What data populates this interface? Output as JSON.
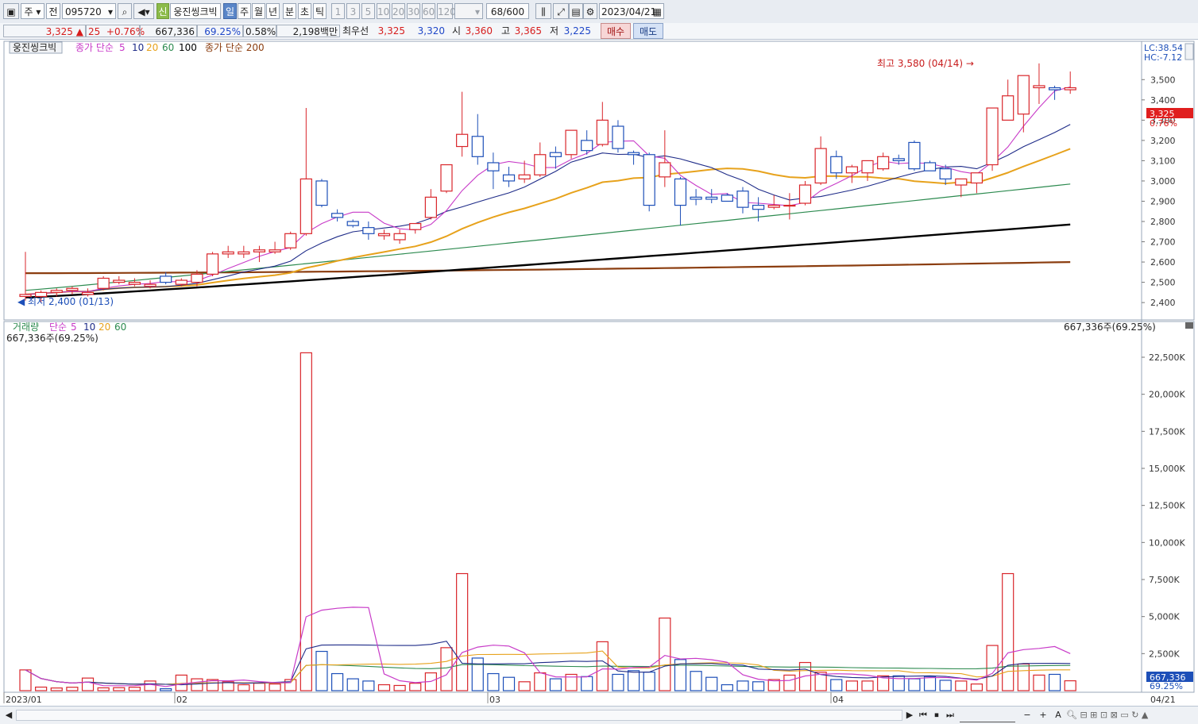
{
  "toolbar": {
    "market": "주",
    "prev": "전",
    "code": "095720",
    "new_badge": "신",
    "name": "웅진씽크빅",
    "periods": [
      "일",
      "주",
      "월",
      "년",
      "분",
      "초",
      "틱"
    ],
    "active_period": "일",
    "minutes": [
      "1",
      "3",
      "5",
      "10",
      "20",
      "30",
      "60",
      "120"
    ],
    "count": "68",
    "count_total": "/600",
    "date": "2023/04/21"
  },
  "info": {
    "price": "3,325",
    "arrow": "▲",
    "change": "25",
    "change_pct": "+0.76%",
    "volume": "667,336",
    "vol_ratio": "69.25%",
    "turnover": "0.58%",
    "amount": "2,198백만",
    "bid_label": "최우선",
    "ask": "3,325",
    "bid": "3,320",
    "open_label": "시",
    "open": "3,360",
    "high_label": "고",
    "high": "3,365",
    "low_label": "저",
    "low": "3,225",
    "buy": "매수",
    "sell": "매도"
  },
  "colors": {
    "up": "#d9262b",
    "down": "#1d4fb8",
    "ma5": "#c83bc8",
    "ma10": "#1e2b88",
    "ma20": "#e7a21c",
    "ma60": "#2c8a4f",
    "ma100": "#000000",
    "ma200": "#8b3d0f"
  },
  "chart_data": [
    {
      "type": "candlestick",
      "title": "웅진씽크빅",
      "legend": {
        "label": "종가 단순",
        "periods": [
          "5",
          "10",
          "20",
          "60",
          "100"
        ],
        "ma200_label": "종가 단순 200"
      },
      "lc": "LC:38.54",
      "hc": "HC:-7.12",
      "price_tag": "3,325",
      "pct_tag": "0.76%",
      "max_label": "최고 3,580 (04/14)",
      "min_label": "최저 2,400 (01/13)",
      "ylim": [
        2330,
        3650
      ],
      "yticks": [
        2400,
        2500,
        2600,
        2700,
        2800,
        2900,
        3000,
        3100,
        3200,
        3300,
        3400,
        3500
      ],
      "ytick_labels": [
        "2,400",
        "2,500",
        "2,600",
        "2,700",
        "2,800",
        "2,900",
        "3,000",
        "3,100",
        "3,200",
        "3,300",
        "3,400",
        "3,500"
      ],
      "xlabels": [
        "2023/01",
        "02",
        "03",
        "04"
      ],
      "x_end_label": "04/21",
      "ohlc": [
        [
          2430,
          2650,
          2410,
          2440
        ],
        [
          2430,
          2460,
          2400,
          2450
        ],
        [
          2450,
          2470,
          2430,
          2460
        ],
        [
          2460,
          2480,
          2440,
          2470
        ],
        [
          2440,
          2470,
          2430,
          2450
        ],
        [
          2470,
          2530,
          2460,
          2520
        ],
        [
          2500,
          2530,
          2490,
          2510
        ],
        [
          2490,
          2520,
          2480,
          2500
        ],
        [
          2480,
          2510,
          2470,
          2490
        ],
        [
          2530,
          2550,
          2490,
          2500
        ],
        [
          2490,
          2520,
          2480,
          2510
        ],
        [
          2500,
          2560,
          2480,
          2540
        ],
        [
          2540,
          2650,
          2530,
          2640
        ],
        [
          2640,
          2680,
          2620,
          2650
        ],
        [
          2640,
          2680,
          2620,
          2650
        ],
        [
          2650,
          2680,
          2600,
          2660
        ],
        [
          2650,
          2700,
          2640,
          2660
        ],
        [
          2670,
          2750,
          2660,
          2740
        ],
        [
          2740,
          3360,
          2730,
          3010
        ],
        [
          3000,
          3010,
          2870,
          2880
        ],
        [
          2840,
          2860,
          2800,
          2820
        ],
        [
          2800,
          2810,
          2770,
          2780
        ],
        [
          2770,
          2800,
          2710,
          2740
        ],
        [
          2730,
          2760,
          2710,
          2740
        ],
        [
          2710,
          2760,
          2690,
          2740
        ],
        [
          2760,
          2790,
          2740,
          2790
        ],
        [
          2820,
          2960,
          2810,
          2920
        ],
        [
          2950,
          3080,
          2940,
          3080
        ],
        [
          3170,
          3440,
          3120,
          3230
        ],
        [
          3220,
          3330,
          3080,
          3120
        ],
        [
          3090,
          3140,
          2960,
          3050
        ],
        [
          3030,
          3070,
          2970,
          3000
        ],
        [
          3010,
          3100,
          2990,
          3030
        ],
        [
          3030,
          3190,
          3020,
          3130
        ],
        [
          3140,
          3170,
          3060,
          3120
        ],
        [
          3130,
          3250,
          3110,
          3250
        ],
        [
          3200,
          3250,
          3130,
          3150
        ],
        [
          3180,
          3390,
          3170,
          3300
        ],
        [
          3270,
          3300,
          3140,
          3160
        ],
        [
          3140,
          3150,
          3080,
          3130
        ],
        [
          3130,
          3140,
          2850,
          2880
        ],
        [
          3020,
          3250,
          2970,
          3090
        ],
        [
          3010,
          3020,
          2780,
          2880
        ],
        [
          2920,
          2960,
          2880,
          2910
        ],
        [
          2920,
          2960,
          2890,
          2910
        ],
        [
          2930,
          2940,
          2900,
          2900
        ],
        [
          2950,
          2970,
          2840,
          2870
        ],
        [
          2880,
          2920,
          2800,
          2860
        ],
        [
          2870,
          2930,
          2860,
          2880
        ],
        [
          2880,
          2940,
          2810,
          2880
        ],
        [
          2890,
          3000,
          2880,
          2980
        ],
        [
          2990,
          3220,
          2980,
          3160
        ],
        [
          3120,
          3150,
          3010,
          3040
        ],
        [
          3040,
          3080,
          2990,
          3070
        ],
        [
          3040,
          3080,
          3000,
          3100
        ],
        [
          3060,
          3140,
          3050,
          3120
        ],
        [
          3110,
          3130,
          3080,
          3100
        ],
        [
          3190,
          3200,
          3050,
          3060
        ],
        [
          3090,
          3100,
          3050,
          3050
        ],
        [
          3060,
          3080,
          2980,
          3010
        ],
        [
          2980,
          3000,
          2920,
          3010
        ],
        [
          2990,
          3040,
          2940,
          3040
        ],
        [
          3080,
          3320,
          3050,
          3360
        ],
        [
          3300,
          3500,
          3320,
          3420
        ],
        [
          3330,
          3520,
          3240,
          3520
        ],
        [
          3460,
          3580,
          3380,
          3470
        ],
        [
          3460,
          3470,
          3400,
          3450
        ],
        [
          3450,
          3540,
          3430,
          3460
        ]
      ]
    },
    {
      "type": "bar",
      "title": "거래량",
      "legend": {
        "label": "단순",
        "periods": [
          "5",
          "10",
          "20",
          "60"
        ]
      },
      "top_left": "667,336주(69.25%)",
      "top_right": "667,336주(69.25%)",
      "vol_tag": "667,336",
      "pct_tag": "69.25%",
      "ylim": [
        0,
        24000
      ],
      "yticks": [
        2500,
        5000,
        7500,
        10000,
        12500,
        15000,
        17500,
        20000,
        22500
      ],
      "ytick_labels": [
        "2,500K",
        "5,000K",
        "7,500K",
        "10,000K",
        "12,500K",
        "15,000K",
        "17,500K",
        "20,000K",
        "22,500K"
      ],
      "volume_k": [
        1400,
        240,
        180,
        230,
        850,
        190,
        200,
        230,
        650,
        130,
        1050,
        800,
        750,
        600,
        400,
        500,
        450,
        750,
        22800,
        2650,
        1150,
        800,
        650,
        400,
        350,
        500,
        1200,
        2900,
        7900,
        2200,
        1150,
        900,
        600,
        1200,
        800,
        1100,
        950,
        3300,
        1100,
        1350,
        1250,
        4900,
        2100,
        1300,
        900,
        400,
        650,
        600,
        750,
        1050,
        1900,
        1250,
        750,
        650,
        650,
        1000,
        1000,
        800,
        950,
        700,
        650,
        450,
        3050,
        7900,
        1800,
        1050,
        1100,
        667
      ]
    }
  ],
  "bottom": {
    "nav": [
      "◀",
      "▶",
      "⏮",
      "⏹",
      "⏭"
    ],
    "zoom": [
      "−",
      "+",
      "A"
    ]
  }
}
